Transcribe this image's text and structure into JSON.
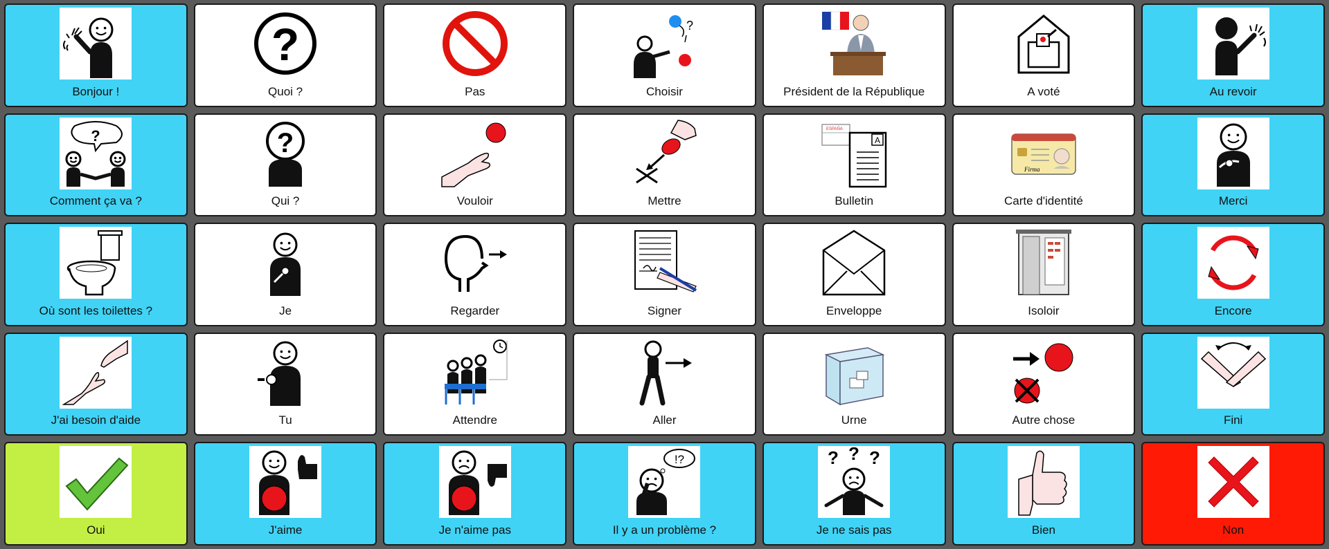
{
  "board": {
    "cells": [
      {
        "label": "Bonjour !",
        "bg": "blue",
        "icon": "person-waving"
      },
      {
        "label": "Quoi ?",
        "bg": "white",
        "icon": "question-circle"
      },
      {
        "label": "Pas",
        "bg": "white",
        "icon": "prohibited"
      },
      {
        "label": "Choisir",
        "bg": "white",
        "icon": "choose"
      },
      {
        "label": "Président de la République",
        "bg": "white",
        "icon": "president"
      },
      {
        "label": "A voté",
        "bg": "white",
        "icon": "voted"
      },
      {
        "label": "Au revoir",
        "bg": "blue",
        "icon": "goodbye"
      },
      {
        "label": "Comment ça va ?",
        "bg": "blue",
        "icon": "how-are-you"
      },
      {
        "label": "Qui ?",
        "bg": "white",
        "icon": "who"
      },
      {
        "label": "Vouloir",
        "bg": "white",
        "icon": "want"
      },
      {
        "label": "Mettre",
        "bg": "white",
        "icon": "put"
      },
      {
        "label": "Bulletin",
        "bg": "white",
        "icon": "ballot"
      },
      {
        "label": "Carte d'identité",
        "bg": "white",
        "icon": "id-card"
      },
      {
        "label": "Merci",
        "bg": "blue",
        "icon": "thanks"
      },
      {
        "label": "Où sont les toilettes ?",
        "bg": "blue",
        "icon": "toilet"
      },
      {
        "label": "Je",
        "bg": "white",
        "icon": "me"
      },
      {
        "label": "Regarder",
        "bg": "white",
        "icon": "look"
      },
      {
        "label": "Signer",
        "bg": "white",
        "icon": "sign"
      },
      {
        "label": "Enveloppe",
        "bg": "white",
        "icon": "envelope"
      },
      {
        "label": "Isoloir",
        "bg": "white",
        "icon": "booth"
      },
      {
        "label": "Encore",
        "bg": "blue",
        "icon": "again"
      },
      {
        "label": "J'ai besoin d'aide",
        "bg": "blue",
        "icon": "help"
      },
      {
        "label": "Tu",
        "bg": "white",
        "icon": "you"
      },
      {
        "label": "Attendre",
        "bg": "white",
        "icon": "wait"
      },
      {
        "label": "Aller",
        "bg": "white",
        "icon": "go"
      },
      {
        "label": "Urne",
        "bg": "white",
        "icon": "ballot-box"
      },
      {
        "label": "Autre chose",
        "bg": "white",
        "icon": "something-else"
      },
      {
        "label": "Fini",
        "bg": "blue",
        "icon": "finished"
      },
      {
        "label": "Oui",
        "bg": "green",
        "icon": "check"
      },
      {
        "label": "J'aime",
        "bg": "blue",
        "icon": "like"
      },
      {
        "label": "Je n'aime pas",
        "bg": "blue",
        "icon": "dislike"
      },
      {
        "label": "Il y a un problème ?",
        "bg": "blue",
        "icon": "problem"
      },
      {
        "label": "Je ne sais pas",
        "bg": "blue",
        "icon": "dont-know"
      },
      {
        "label": "Bien",
        "bg": "blue",
        "icon": "thumbs-up"
      },
      {
        "label": "Non",
        "bg": "red",
        "icon": "cross"
      }
    ]
  }
}
